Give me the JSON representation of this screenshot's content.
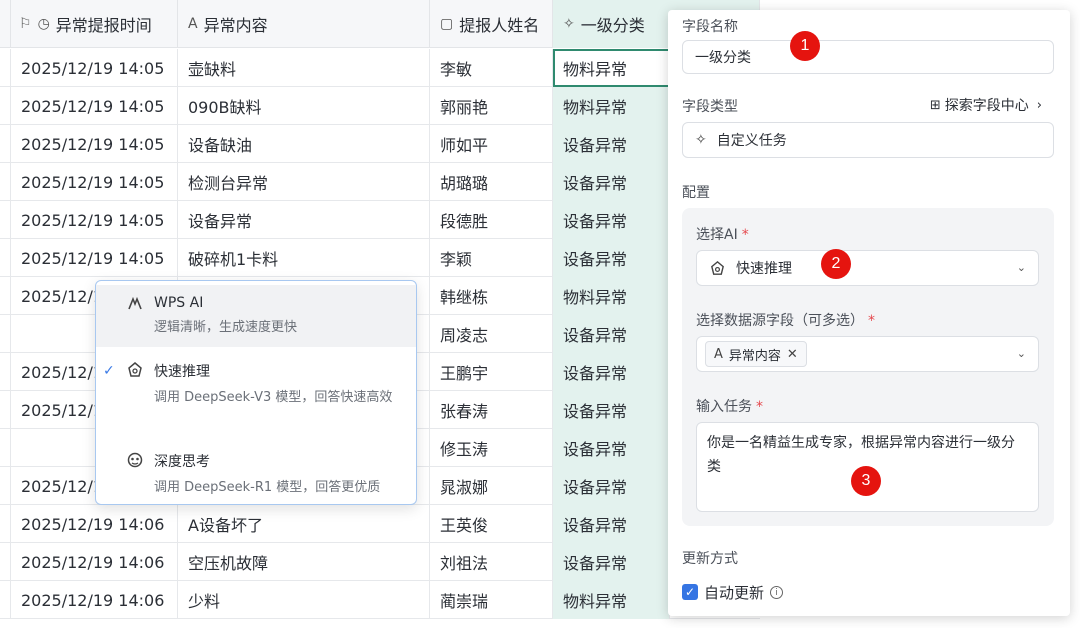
{
  "columns": {
    "time": "异常提报时间",
    "content": "异常内容",
    "name": "提报人姓名",
    "category": "一级分类"
  },
  "rows": [
    {
      "time": "2025/12/19 14:05",
      "content": "壶缺料",
      "name": "李敏",
      "category": "物料异常"
    },
    {
      "time": "2025/12/19 14:05",
      "content": "090B缺料",
      "name": "郭丽艳",
      "category": "物料异常"
    },
    {
      "time": "2025/12/19 14:05",
      "content": "设备缺油",
      "name": "师如平",
      "category": "设备异常"
    },
    {
      "time": "2025/12/19 14:05",
      "content": "检测台异常",
      "name": "胡璐璐",
      "category": "设备异常"
    },
    {
      "time": "2025/12/19 14:05",
      "content": "设备异常",
      "name": "段德胜",
      "category": "设备异常"
    },
    {
      "time": "2025/12/19 14:05",
      "content": "破碎机1卡料",
      "name": "李颖",
      "category": "设备异常"
    },
    {
      "time": "2025/12/1",
      "content": "",
      "name": "韩继栋",
      "category": "物料异常"
    },
    {
      "time": "",
      "content": "",
      "name": "周凌志",
      "category": "设备异常"
    },
    {
      "time": "2025/12/1",
      "content": "",
      "name": "王鹏宇",
      "category": "设备异常"
    },
    {
      "time": "2025/12/1",
      "content": "",
      "name": "张春涛",
      "category": "设备异常"
    },
    {
      "time": "",
      "content": "",
      "name": "修玉涛",
      "category": "设备异常"
    },
    {
      "time": "2025/12/1",
      "content": "",
      "name": "晁淑娜",
      "category": "设备异常"
    },
    {
      "time": "2025/12/19 14:06",
      "content": "A设备坏了",
      "name": "王英俊",
      "category": "设备异常"
    },
    {
      "time": "2025/12/19 14:06",
      "content": "空压机故障",
      "name": "刘祖法",
      "category": "设备异常"
    },
    {
      "time": "2025/12/19 14:06",
      "content": "少料",
      "name": "蔺崇瑞",
      "category": "物料异常"
    }
  ],
  "menu": {
    "items": [
      {
        "title": "WPS AI",
        "desc": "逻辑清晰，生成速度更快"
      },
      {
        "title": "快速推理",
        "desc": "调用 DeepSeek-V3 模型，回答快速高效"
      },
      {
        "title": "深度思考",
        "desc": "调用 DeepSeek-R1 模型，回答更优质"
      }
    ],
    "check": "✓"
  },
  "panel": {
    "field_name_label": "字段名称",
    "field_name_value": "一级分类",
    "field_type_label": "字段类型",
    "explore_label": "探索字段中心",
    "field_type_value": "自定义任务",
    "config_label": "配置",
    "ai_label": "选择AI",
    "ai_value": "快速推理",
    "source_label": "选择数据源字段（可多选）",
    "source_tag": "异常内容",
    "task_label": "输入任务",
    "task_value": "你是一名精益生成专家，根据异常内容进行一级分类",
    "update_label": "更新方式",
    "auto_update": "自动更新",
    "required_mark": "*"
  },
  "badges": [
    "1",
    "2",
    "3"
  ],
  "colors": {
    "accent": "#3575e3",
    "category_bg": "#e3f2ee",
    "badge": "#e5140f"
  }
}
